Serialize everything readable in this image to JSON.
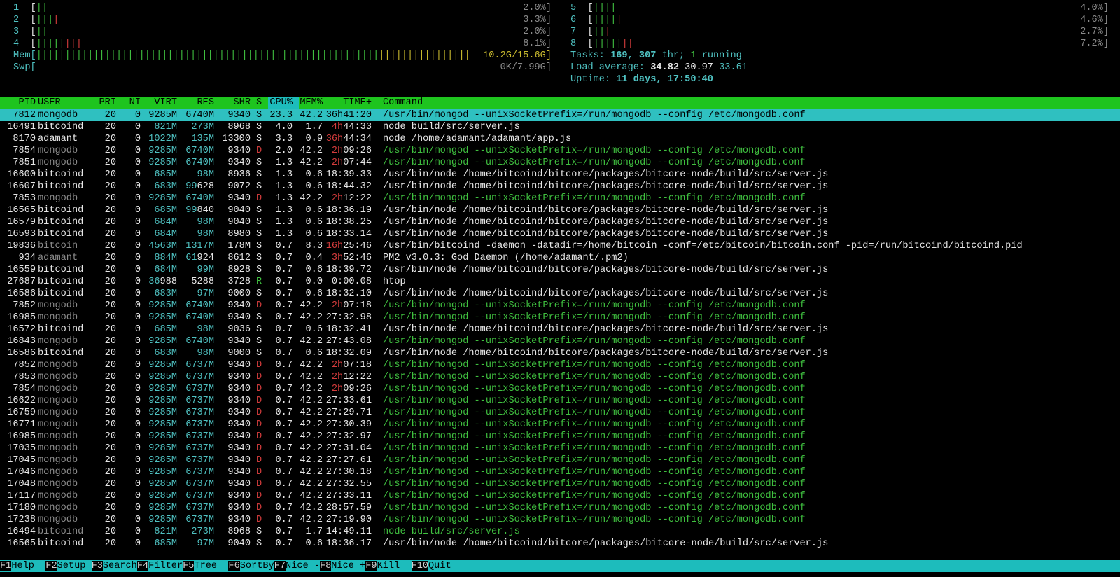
{
  "cpus": [
    {
      "id": "1",
      "green": 2,
      "red": 0,
      "pct": "2.0%]"
    },
    {
      "id": "2",
      "green": 3,
      "red": 1,
      "pct": "3.3%]"
    },
    {
      "id": "3",
      "green": 2,
      "red": 0,
      "pct": "2.0%]"
    },
    {
      "id": "4",
      "green": 5,
      "red": 3,
      "pct": "8.1%]"
    },
    {
      "id": "5",
      "green": 4,
      "red": 0,
      "pct": "4.0%]"
    },
    {
      "id": "6",
      "green": 4,
      "red": 1,
      "pct": "4.6%]"
    },
    {
      "id": "7",
      "green": 2,
      "red": 1,
      "pct": "2.7%]"
    },
    {
      "id": "8",
      "green": 5,
      "red": 2,
      "pct": "7.2%]"
    }
  ],
  "mem": {
    "label": "Mem[",
    "value": "10.2G/15.6G]",
    "green_bars": 145,
    "yellow_bars": 16
  },
  "swp": {
    "label": "Swp[",
    "value": "0K/7.99G]"
  },
  "tasks": {
    "label": "Tasks: ",
    "count": "169",
    "sep": ", ",
    "thr": "307",
    "thr_label": " thr; ",
    "running": "1",
    "running_label": " running"
  },
  "load": {
    "label": "Load average: ",
    "l1": "34.82",
    "l5": "30.97",
    "l15": "33.61"
  },
  "uptime": {
    "label": "Uptime: ",
    "value": "11 days, 17:50:40"
  },
  "columns": [
    "PID",
    "USER",
    "PRI",
    "NI",
    "VIRT",
    "RES",
    "SHR",
    "S",
    "CPU%",
    "MEM%",
    "TIME+",
    "Command"
  ],
  "processes": [
    {
      "pid": "7812",
      "user": "mongodb",
      "pri": "20",
      "ni": "0",
      "virt": "9285M",
      "res": "6740M",
      "shr": "9340",
      "s": "S",
      "cpu": "23.3",
      "mem": "42.2",
      "time": "36h41:20",
      "cmd": "/usr/bin/mongod --unixSocketPrefix=/run/mongodb --config /etc/mongodb.conf",
      "selected": true
    },
    {
      "pid": "16491",
      "user": "bitcoind",
      "pri": "20",
      "ni": "0",
      "virt": "821M",
      "res": "273M",
      "shr": "8968",
      "s": "S",
      "cpu": "4.0",
      "mem": "1.7",
      "time": "4h44:33",
      "cmd": "node build/src/server.js"
    },
    {
      "pid": "8170",
      "user": "adamant",
      "pri": "20",
      "ni": "0",
      "virt": "1022M",
      "res": "135M",
      "shr": "13300",
      "s": "S",
      "cpu": "3.3",
      "mem": "0.9",
      "time": "36h44:34",
      "cmd": "node /home/adamant/adamant/app.js"
    },
    {
      "pid": "7854",
      "user": "mongodb",
      "pri": "20",
      "ni": "0",
      "virt": "9285M",
      "res": "6740M",
      "shr": "9340",
      "s": "D",
      "cpu": "2.0",
      "mem": "42.2",
      "time": "2h09:26",
      "cmd": "/usr/bin/mongod --unixSocketPrefix=/run/mongodb --config /etc/mongodb.conf",
      "thread": true
    },
    {
      "pid": "7851",
      "user": "mongodb",
      "pri": "20",
      "ni": "0",
      "virt": "9285M",
      "res": "6740M",
      "shr": "9340",
      "s": "S",
      "cpu": "1.3",
      "mem": "42.2",
      "time": "2h07:44",
      "cmd": "/usr/bin/mongod --unixSocketPrefix=/run/mongodb --config /etc/mongodb.conf",
      "thread": true
    },
    {
      "pid": "16600",
      "user": "bitcoind",
      "pri": "20",
      "ni": "0",
      "virt": "685M",
      "res": "98M",
      "shr": "8936",
      "s": "S",
      "cpu": "1.3",
      "mem": "0.6",
      "time": "18:39.33",
      "cmd": "/usr/bin/node /home/bitcoind/bitcore/packages/bitcore-node/build/src/server.js"
    },
    {
      "pid": "16607",
      "user": "bitcoind",
      "pri": "20",
      "ni": "0",
      "virt": "683M",
      "res": "99628",
      "shr": "9072",
      "s": "S",
      "cpu": "1.3",
      "mem": "0.6",
      "time": "18:44.32",
      "cmd": "/usr/bin/node /home/bitcoind/bitcore/packages/bitcore-node/build/src/server.js"
    },
    {
      "pid": "7853",
      "user": "mongodb",
      "pri": "20",
      "ni": "0",
      "virt": "9285M",
      "res": "6740M",
      "shr": "9340",
      "s": "D",
      "cpu": "1.3",
      "mem": "42.2",
      "time": "2h12:22",
      "cmd": "/usr/bin/mongod --unixSocketPrefix=/run/mongodb --config /etc/mongodb.conf",
      "thread": true
    },
    {
      "pid": "16565",
      "user": "bitcoind",
      "pri": "20",
      "ni": "0",
      "virt": "685M",
      "res": "99840",
      "shr": "9040",
      "s": "S",
      "cpu": "1.3",
      "mem": "0.6",
      "time": "18:36.19",
      "cmd": "/usr/bin/node /home/bitcoind/bitcore/packages/bitcore-node/build/src/server.js"
    },
    {
      "pid": "16579",
      "user": "bitcoind",
      "pri": "20",
      "ni": "0",
      "virt": "684M",
      "res": "98M",
      "shr": "9040",
      "s": "S",
      "cpu": "1.3",
      "mem": "0.6",
      "time": "18:38.25",
      "cmd": "/usr/bin/node /home/bitcoind/bitcore/packages/bitcore-node/build/src/server.js"
    },
    {
      "pid": "16593",
      "user": "bitcoind",
      "pri": "20",
      "ni": "0",
      "virt": "684M",
      "res": "98M",
      "shr": "8980",
      "s": "S",
      "cpu": "1.3",
      "mem": "0.6",
      "time": "18:33.14",
      "cmd": "/usr/bin/node /home/bitcoind/bitcore/packages/bitcore-node/build/src/server.js"
    },
    {
      "pid": "19836",
      "user": "bitcoin",
      "pri": "20",
      "ni": "0",
      "virt": "4563M",
      "res": "1317M",
      "shr": "178M",
      "s": "S",
      "cpu": "0.7",
      "mem": "8.3",
      "time": "16h25:46",
      "cmd": "/usr/bin/bitcoind -daemon -datadir=/home/bitcoin -conf=/etc/bitcoin/bitcoin.conf -pid=/run/bitcoind/bitcoind.pid",
      "dimuser": true
    },
    {
      "pid": "934",
      "user": "adamant",
      "pri": "20",
      "ni": "0",
      "virt": "884M",
      "res": "61924",
      "shr": "8612",
      "s": "S",
      "cpu": "0.7",
      "mem": "0.4",
      "time": "3h52:46",
      "cmd": "PM2 v3.0.3: God Daemon (/home/adamant/.pm2)",
      "dimuser": true
    },
    {
      "pid": "16559",
      "user": "bitcoind",
      "pri": "20",
      "ni": "0",
      "virt": "684M",
      "res": "99M",
      "shr": "8928",
      "s": "S",
      "cpu": "0.7",
      "mem": "0.6",
      "time": "18:39.72",
      "cmd": "/usr/bin/node /home/bitcoind/bitcore/packages/bitcore-node/build/src/server.js"
    },
    {
      "pid": "27687",
      "user": "bitcoind",
      "pri": "20",
      "ni": "0",
      "virt": "36988",
      "res": "5288",
      "shr": "3728",
      "s": "R",
      "cpu": "0.7",
      "mem": "0.0",
      "time": "0:00.08",
      "cmd": "htop"
    },
    {
      "pid": "16586",
      "user": "bitcoind",
      "pri": "20",
      "ni": "0",
      "virt": "683M",
      "res": "97M",
      "shr": "9000",
      "s": "S",
      "cpu": "0.7",
      "mem": "0.6",
      "time": "18:32.10",
      "cmd": "/usr/bin/node /home/bitcoind/bitcore/packages/bitcore-node/build/src/server.js"
    },
    {
      "pid": "7852",
      "user": "mongodb",
      "pri": "20",
      "ni": "0",
      "virt": "9285M",
      "res": "6740M",
      "shr": "9340",
      "s": "D",
      "cpu": "0.7",
      "mem": "42.2",
      "time": "2h07:18",
      "cmd": "/usr/bin/mongod --unixSocketPrefix=/run/mongodb --config /etc/mongodb.conf",
      "thread": true
    },
    {
      "pid": "16985",
      "user": "mongodb",
      "pri": "20",
      "ni": "0",
      "virt": "9285M",
      "res": "6740M",
      "shr": "9340",
      "s": "S",
      "cpu": "0.7",
      "mem": "42.2",
      "time": "27:32.98",
      "cmd": "/usr/bin/mongod --unixSocketPrefix=/run/mongodb --config /etc/mongodb.conf",
      "thread": true
    },
    {
      "pid": "16572",
      "user": "bitcoind",
      "pri": "20",
      "ni": "0",
      "virt": "685M",
      "res": "98M",
      "shr": "9036",
      "s": "S",
      "cpu": "0.7",
      "mem": "0.6",
      "time": "18:32.41",
      "cmd": "/usr/bin/node /home/bitcoind/bitcore/packages/bitcore-node/build/src/server.js"
    },
    {
      "pid": "16843",
      "user": "mongodb",
      "pri": "20",
      "ni": "0",
      "virt": "9285M",
      "res": "6740M",
      "shr": "9340",
      "s": "S",
      "cpu": "0.7",
      "mem": "42.2",
      "time": "27:43.08",
      "cmd": "/usr/bin/mongod --unixSocketPrefix=/run/mongodb --config /etc/mongodb.conf",
      "thread": true
    },
    {
      "pid": "16586",
      "user": "bitcoind",
      "pri": "20",
      "ni": "0",
      "virt": "683M",
      "res": "98M",
      "shr": "9000",
      "s": "S",
      "cpu": "0.7",
      "mem": "0.6",
      "time": "18:32.09",
      "cmd": "/usr/bin/node /home/bitcoind/bitcore/packages/bitcore-node/build/src/server.js"
    },
    {
      "pid": "7852",
      "user": "mongodb",
      "pri": "20",
      "ni": "0",
      "virt": "9285M",
      "res": "6737M",
      "shr": "9340",
      "s": "D",
      "cpu": "0.7",
      "mem": "42.2",
      "time": "2h07:18",
      "cmd": "/usr/bin/mongod --unixSocketPrefix=/run/mongodb --config /etc/mongodb.conf",
      "thread": true
    },
    {
      "pid": "7853",
      "user": "mongodb",
      "pri": "20",
      "ni": "0",
      "virt": "9285M",
      "res": "6737M",
      "shr": "9340",
      "s": "D",
      "cpu": "0.7",
      "mem": "42.2",
      "time": "2h12:22",
      "cmd": "/usr/bin/mongod --unixSocketPrefix=/run/mongodb --config /etc/mongodb.conf",
      "thread": true
    },
    {
      "pid": "7854",
      "user": "mongodb",
      "pri": "20",
      "ni": "0",
      "virt": "9285M",
      "res": "6737M",
      "shr": "9340",
      "s": "D",
      "cpu": "0.7",
      "mem": "42.2",
      "time": "2h09:26",
      "cmd": "/usr/bin/mongod --unixSocketPrefix=/run/mongodb --config /etc/mongodb.conf",
      "thread": true
    },
    {
      "pid": "16622",
      "user": "mongodb",
      "pri": "20",
      "ni": "0",
      "virt": "9285M",
      "res": "6737M",
      "shr": "9340",
      "s": "D",
      "cpu": "0.7",
      "mem": "42.2",
      "time": "27:33.61",
      "cmd": "/usr/bin/mongod --unixSocketPrefix=/run/mongodb --config /etc/mongodb.conf",
      "thread": true
    },
    {
      "pid": "16759",
      "user": "mongodb",
      "pri": "20",
      "ni": "0",
      "virt": "9285M",
      "res": "6737M",
      "shr": "9340",
      "s": "D",
      "cpu": "0.7",
      "mem": "42.2",
      "time": "27:29.71",
      "cmd": "/usr/bin/mongod --unixSocketPrefix=/run/mongodb --config /etc/mongodb.conf",
      "thread": true
    },
    {
      "pid": "16771",
      "user": "mongodb",
      "pri": "20",
      "ni": "0",
      "virt": "9285M",
      "res": "6737M",
      "shr": "9340",
      "s": "D",
      "cpu": "0.7",
      "mem": "42.2",
      "time": "27:30.39",
      "cmd": "/usr/bin/mongod --unixSocketPrefix=/run/mongodb --config /etc/mongodb.conf",
      "thread": true
    },
    {
      "pid": "16985",
      "user": "mongodb",
      "pri": "20",
      "ni": "0",
      "virt": "9285M",
      "res": "6737M",
      "shr": "9340",
      "s": "D",
      "cpu": "0.7",
      "mem": "42.2",
      "time": "27:32.97",
      "cmd": "/usr/bin/mongod --unixSocketPrefix=/run/mongodb --config /etc/mongodb.conf",
      "thread": true
    },
    {
      "pid": "17035",
      "user": "mongodb",
      "pri": "20",
      "ni": "0",
      "virt": "9285M",
      "res": "6737M",
      "shr": "9340",
      "s": "D",
      "cpu": "0.7",
      "mem": "42.2",
      "time": "27:31.04",
      "cmd": "/usr/bin/mongod --unixSocketPrefix=/run/mongodb --config /etc/mongodb.conf",
      "thread": true
    },
    {
      "pid": "17045",
      "user": "mongodb",
      "pri": "20",
      "ni": "0",
      "virt": "9285M",
      "res": "6737M",
      "shr": "9340",
      "s": "D",
      "cpu": "0.7",
      "mem": "42.2",
      "time": "27:27.61",
      "cmd": "/usr/bin/mongod --unixSocketPrefix=/run/mongodb --config /etc/mongodb.conf",
      "thread": true
    },
    {
      "pid": "17046",
      "user": "mongodb",
      "pri": "20",
      "ni": "0",
      "virt": "9285M",
      "res": "6737M",
      "shr": "9340",
      "s": "D",
      "cpu": "0.7",
      "mem": "42.2",
      "time": "27:30.18",
      "cmd": "/usr/bin/mongod --unixSocketPrefix=/run/mongodb --config /etc/mongodb.conf",
      "thread": true
    },
    {
      "pid": "17048",
      "user": "mongodb",
      "pri": "20",
      "ni": "0",
      "virt": "9285M",
      "res": "6737M",
      "shr": "9340",
      "s": "D",
      "cpu": "0.7",
      "mem": "42.2",
      "time": "27:32.55",
      "cmd": "/usr/bin/mongod --unixSocketPrefix=/run/mongodb --config /etc/mongodb.conf",
      "thread": true
    },
    {
      "pid": "17117",
      "user": "mongodb",
      "pri": "20",
      "ni": "0",
      "virt": "9285M",
      "res": "6737M",
      "shr": "9340",
      "s": "D",
      "cpu": "0.7",
      "mem": "42.2",
      "time": "27:33.11",
      "cmd": "/usr/bin/mongod --unixSocketPrefix=/run/mongodb --config /etc/mongodb.conf",
      "thread": true
    },
    {
      "pid": "17180",
      "user": "mongodb",
      "pri": "20",
      "ni": "0",
      "virt": "9285M",
      "res": "6737M",
      "shr": "9340",
      "s": "D",
      "cpu": "0.7",
      "mem": "42.2",
      "time": "28:57.59",
      "cmd": "/usr/bin/mongod --unixSocketPrefix=/run/mongodb --config /etc/mongodb.conf",
      "thread": true
    },
    {
      "pid": "17238",
      "user": "mongodb",
      "pri": "20",
      "ni": "0",
      "virt": "9285M",
      "res": "6737M",
      "shr": "9340",
      "s": "D",
      "cpu": "0.7",
      "mem": "42.2",
      "time": "27:19.90",
      "cmd": "/usr/bin/mongod --unixSocketPrefix=/run/mongodb --config /etc/mongodb.conf",
      "thread": true
    },
    {
      "pid": "16494",
      "user": "bitcoind",
      "pri": "20",
      "ni": "0",
      "virt": "821M",
      "res": "273M",
      "shr": "8968",
      "s": "S",
      "cpu": "0.7",
      "mem": "1.7",
      "time": "14:49.11",
      "cmd": "node build/src/server.js",
      "thread": true
    },
    {
      "pid": "16565",
      "user": "bitcoind",
      "pri": "20",
      "ni": "0",
      "virt": "685M",
      "res": "97M",
      "shr": "9040",
      "s": "S",
      "cpu": "0.7",
      "mem": "0.6",
      "time": "18:36.17",
      "cmd": "/usr/bin/node /home/bitcoind/bitcore/packages/bitcore-node/build/src/server.js"
    }
  ],
  "footer": [
    {
      "key": "F1",
      "label": "Help  "
    },
    {
      "key": "F2",
      "label": "Setup "
    },
    {
      "key": "F3",
      "label": "Search"
    },
    {
      "key": "F4",
      "label": "Filter"
    },
    {
      "key": "F5",
      "label": "Tree  "
    },
    {
      "key": "F6",
      "label": "SortBy"
    },
    {
      "key": "F7",
      "label": "Nice -"
    },
    {
      "key": "F8",
      "label": "Nice +"
    },
    {
      "key": "F9",
      "label": "Kill  "
    },
    {
      "key": "F10",
      "label": "Quit"
    }
  ],
  "colors": {
    "cyan": "#4fc1c1",
    "green": "#3fbf3f",
    "red": "#d43c3c",
    "header_bg": "#1ec41e",
    "selected_bg": "#2fc0c0"
  }
}
